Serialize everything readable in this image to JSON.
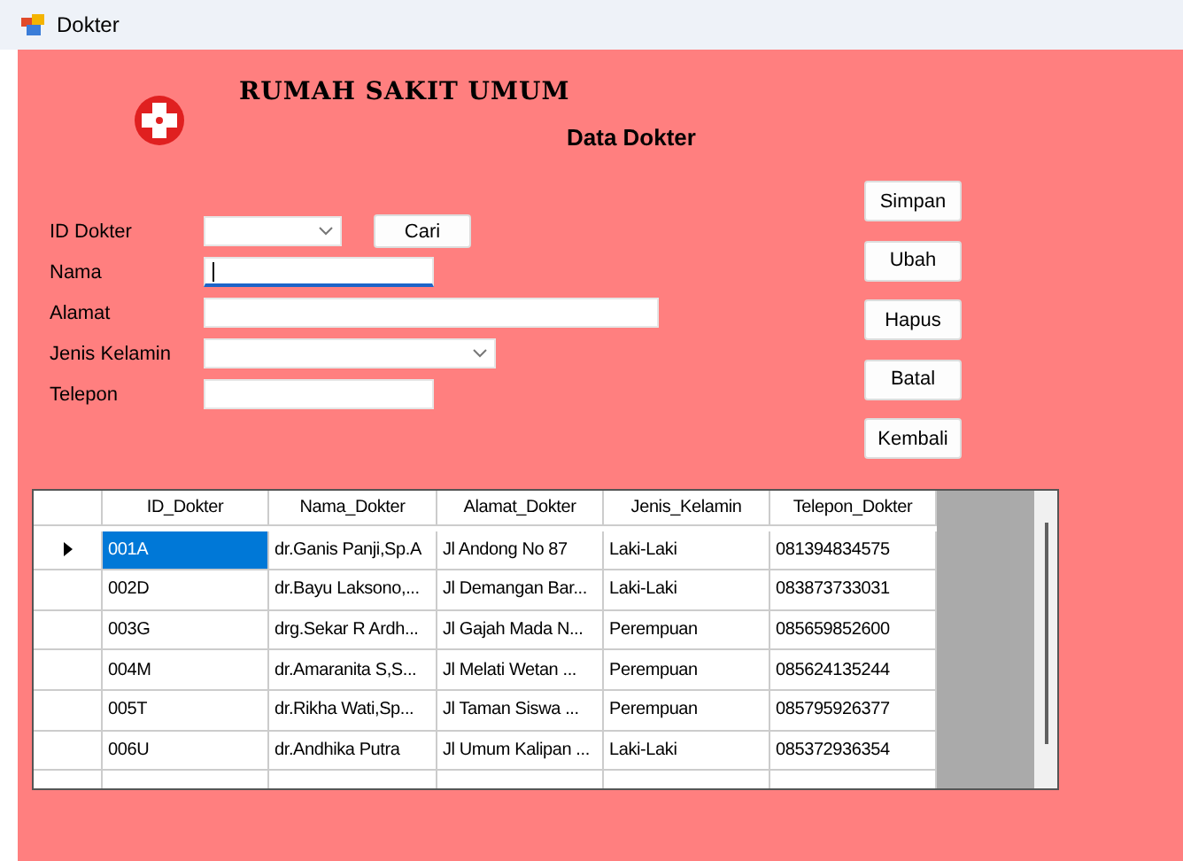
{
  "window": {
    "title": "Dokter"
  },
  "header": {
    "hospital_name": "RUMAH SAKIT UMUM",
    "form_title": "Data Dokter"
  },
  "fields": [
    {
      "label": "ID Dokter",
      "kind": "combo",
      "focused": false
    },
    {
      "label": "Nama",
      "kind": "text",
      "focused": true
    },
    {
      "label": "Alamat",
      "kind": "text",
      "focused": false
    },
    {
      "label": "Jenis Kelamin",
      "kind": "combo",
      "focused": false
    },
    {
      "label": "Telepon",
      "kind": "text",
      "focused": false
    }
  ],
  "search_button": "Cari",
  "buttons": [
    "Simpan",
    "Ubah",
    "Hapus",
    "Batal",
    "Kembali"
  ],
  "table": {
    "columns": [
      "ID_Dokter",
      "Nama_Dokter",
      "Alamat_Dokter",
      "Jenis_Kelamin",
      "Telepon_Dokter"
    ],
    "rows": [
      {
        "selected": true,
        "cells": [
          "001A",
          "dr.Ganis Panji,Sp.A",
          "Jl Andong No 87",
          "Laki-Laki",
          "081394834575"
        ]
      },
      {
        "selected": false,
        "cells": [
          "002D",
          "dr.Bayu Laksono,...",
          "Jl Demangan Bar...",
          "Laki-Laki",
          "083873733031"
        ]
      },
      {
        "selected": false,
        "cells": [
          "003G",
          "drg.Sekar R Ardh...",
          "Jl Gajah Mada N...",
          "Perempuan",
          "085659852600"
        ]
      },
      {
        "selected": false,
        "cells": [
          "004M",
          "dr.Amaranita S,S...",
          "Jl Melati Wetan ...",
          "Perempuan",
          "085624135244"
        ]
      },
      {
        "selected": false,
        "cells": [
          "005T",
          "dr.Rikha Wati,Sp...",
          "Jl Taman Siswa ...",
          "Perempuan",
          "085795926377"
        ]
      },
      {
        "selected": false,
        "cells": [
          "006U",
          "dr.Andhika Putra",
          "Jl Umum Kalipan ...",
          "Laki-Laki",
          "085372936354"
        ]
      }
    ]
  }
}
